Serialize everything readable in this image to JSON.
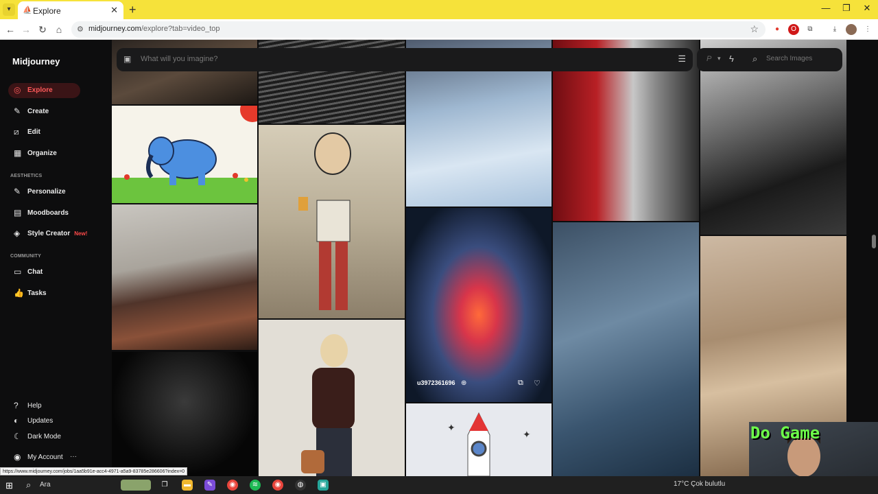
{
  "browser": {
    "tab_title": "Explore",
    "url_host": "midjourney.com",
    "url_path": "/explore?tab=video_top",
    "status_url": "https://www.midjourney.com/jobs/1aa5b91e-acc4-4971-a5a9-83785e286606?index=0"
  },
  "app": {
    "brand": "Midjourney",
    "nav": [
      {
        "label": "Explore",
        "icon": "compass-icon"
      },
      {
        "label": "Create",
        "icon": "paintbrush-icon"
      },
      {
        "label": "Edit",
        "icon": "edit-icon"
      },
      {
        "label": "Organize",
        "icon": "grid-icon"
      }
    ],
    "aesthetics_title": "AESTHETICS",
    "aesthetics": [
      {
        "label": "Personalize",
        "icon": "edit-icon"
      },
      {
        "label": "Moodboards",
        "icon": "moodboard-icon"
      },
      {
        "label": "Style Creator",
        "icon": "style-icon",
        "badge": "New!"
      }
    ],
    "community_title": "COMMUNITY",
    "community": [
      {
        "label": "Chat",
        "icon": "chat-icon"
      },
      {
        "label": "Tasks",
        "icon": "thumbs-up-icon"
      }
    ],
    "footer": [
      {
        "label": "Help",
        "icon": "help-icon"
      },
      {
        "label": "Updates",
        "icon": "updates-icon"
      },
      {
        "label": "Dark Mode",
        "icon": "moon-icon"
      },
      {
        "label": "My Account",
        "icon": "account-icon"
      }
    ],
    "prompt_placeholder": "What will you imagine?",
    "search_placeholder": "Search Images",
    "personalize_letter": "P"
  },
  "gallery": {
    "hover_owner": "u3972361696"
  },
  "webcam_text": "Do Game",
  "taskbar": {
    "search_label": "Ara",
    "weather": "17°C  Çok bulutlu"
  },
  "colors": {
    "accent": "#ff5a5a",
    "active_bg": "#3a1416",
    "tabbar": "#f6e23a"
  }
}
